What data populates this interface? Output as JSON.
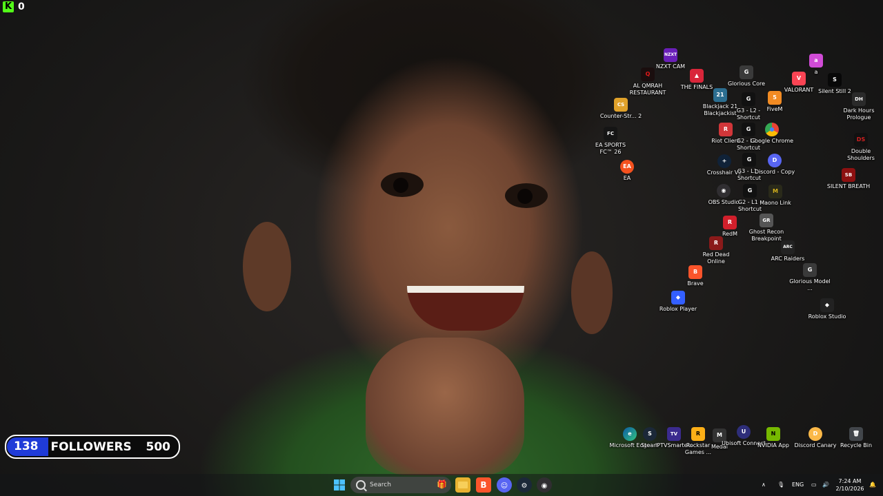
{
  "kick": {
    "logo": "K",
    "count": "0"
  },
  "followers": {
    "current": "138",
    "label": "FOLLOWERS",
    "goal": "500",
    "progress": 0.276
  },
  "desktop_icons": [
    {
      "id": "nzxt",
      "label": "NZXT CAM",
      "glyph": "NZXT"
    },
    {
      "id": "alqmrah",
      "label": "AL QMRAH RESTAURANT",
      "glyph": "Q"
    },
    {
      "id": "thefinals",
      "label": "THE FINALS",
      "glyph": "▲"
    },
    {
      "id": "gloriouscore",
      "label": "Glorious Core",
      "glyph": "G"
    },
    {
      "id": "valorant",
      "label": "VALORANT",
      "glyph": "V"
    },
    {
      "id": "a",
      "label": "a",
      "glyph": "a"
    },
    {
      "id": "silentstill2",
      "label": "Silent Still 2",
      "glyph": "S"
    },
    {
      "id": "darkhours",
      "label": "Dark Hours Prologue",
      "glyph": "DH"
    },
    {
      "id": "counterstrike",
      "label": "Counter-Str... 2",
      "glyph": "CS"
    },
    {
      "id": "blackjack",
      "label": "Blackjack 21 Blackjackist",
      "glyph": "21"
    },
    {
      "id": "g3l2",
      "label": "G3 - L2 - Shortcut",
      "glyph": "G"
    },
    {
      "id": "fivem",
      "label": "FiveM",
      "glyph": "5"
    },
    {
      "id": "easports",
      "label": "EA SPORTS FC™ 26",
      "glyph": "FC"
    },
    {
      "id": "riotclient",
      "label": "Riot Client",
      "glyph": "R"
    },
    {
      "id": "g2l2",
      "label": "G2 - L2 - Shortcut",
      "glyph": "G"
    },
    {
      "id": "chrome",
      "label": "Google Chrome",
      "glyph": "●"
    },
    {
      "id": "doubleshoulders",
      "label": "Double Shoulders",
      "glyph": "DS"
    },
    {
      "id": "ea",
      "label": "EA",
      "glyph": "EA"
    },
    {
      "id": "crosshair",
      "label": "Crosshair V2",
      "glyph": "+"
    },
    {
      "id": "g3l1",
      "label": "G3 - L1 - Shortcut",
      "glyph": "G"
    },
    {
      "id": "discordcopy",
      "label": "Discord - Copy",
      "glyph": "D"
    },
    {
      "id": "silentbreath",
      "label": "SILENT BREATH",
      "glyph": "SB"
    },
    {
      "id": "obs",
      "label": "OBS Studio",
      "glyph": "◉"
    },
    {
      "id": "g2l1",
      "label": "G2 - L1 - Shortcut",
      "glyph": "G"
    },
    {
      "id": "maono",
      "label": "Maono Link",
      "glyph": "M"
    },
    {
      "id": "redm",
      "label": "RedM",
      "glyph": "R"
    },
    {
      "id": "ghostrecon",
      "label": "Ghost Recon Breakpoint",
      "glyph": "GR"
    },
    {
      "id": "reddead",
      "label": "Red Dead Online",
      "glyph": "R"
    },
    {
      "id": "arcraiders",
      "label": "ARC Raiders",
      "glyph": "ARC"
    },
    {
      "id": "brave",
      "label": "Brave",
      "glyph": "B"
    },
    {
      "id": "gloriousmodel",
      "label": "Glorious Model ...",
      "glyph": "G"
    },
    {
      "id": "roblox",
      "label": "Roblox Player",
      "glyph": "◆"
    },
    {
      "id": "robloxstudio",
      "label": "Roblox Studio",
      "glyph": "◆"
    },
    {
      "id": "edge",
      "label": "Microsoft Edge",
      "glyph": "e"
    },
    {
      "id": "steam",
      "label": "Steam",
      "glyph": "S"
    },
    {
      "id": "iptv",
      "label": "IPTVSmarters",
      "glyph": "TV"
    },
    {
      "id": "rockstar",
      "label": "Rockstar Games ...",
      "glyph": "R"
    },
    {
      "id": "medal",
      "label": "Medal",
      "glyph": "M"
    },
    {
      "id": "ubisoft",
      "label": "Ubisoft Connect",
      "glyph": "U"
    },
    {
      "id": "nvidia",
      "label": "NVIDIA App",
      "glyph": "N"
    },
    {
      "id": "discordcanary",
      "label": "Discord Canary",
      "glyph": "D"
    },
    {
      "id": "recyclebin",
      "label": "Recycle Bin",
      "glyph": "🗑"
    }
  ],
  "taskbar": {
    "search_placeholder": "Search",
    "pinned": [
      {
        "id": "start",
        "icon": "windows-icon"
      },
      {
        "id": "explorer",
        "icon": "folder-icon"
      },
      {
        "id": "brave",
        "icon": "brave-icon"
      },
      {
        "id": "discord",
        "icon": "discord-icon"
      },
      {
        "id": "steam",
        "icon": "steam-icon"
      },
      {
        "id": "obs",
        "icon": "obs-icon"
      }
    ],
    "language": "ENG",
    "time": "7:24 AM",
    "date": "2/10/2026"
  },
  "colors": {
    "followers_fill": "#1f3bd8",
    "kick_green": "#53fc18",
    "taskbar": "#141618"
  }
}
